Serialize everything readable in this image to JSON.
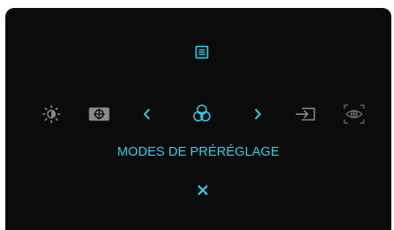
{
  "osd": {
    "menu_label": "MODES DE PRÉRÉGLAGE",
    "top_icon": "menu-list-icon",
    "row_icons": [
      "brightness-contrast-icon",
      "auto-adjust-icon",
      "chevron-left-icon",
      "color-preset-modes-icon",
      "chevron-right-icon",
      "input-source-icon",
      "eye-comfort-icon"
    ],
    "bottom_icon": "close-icon"
  },
  "colors": {
    "background": "#0b0b0b",
    "accent": "#2fd0ee",
    "inactive": "#8a8a8a"
  }
}
